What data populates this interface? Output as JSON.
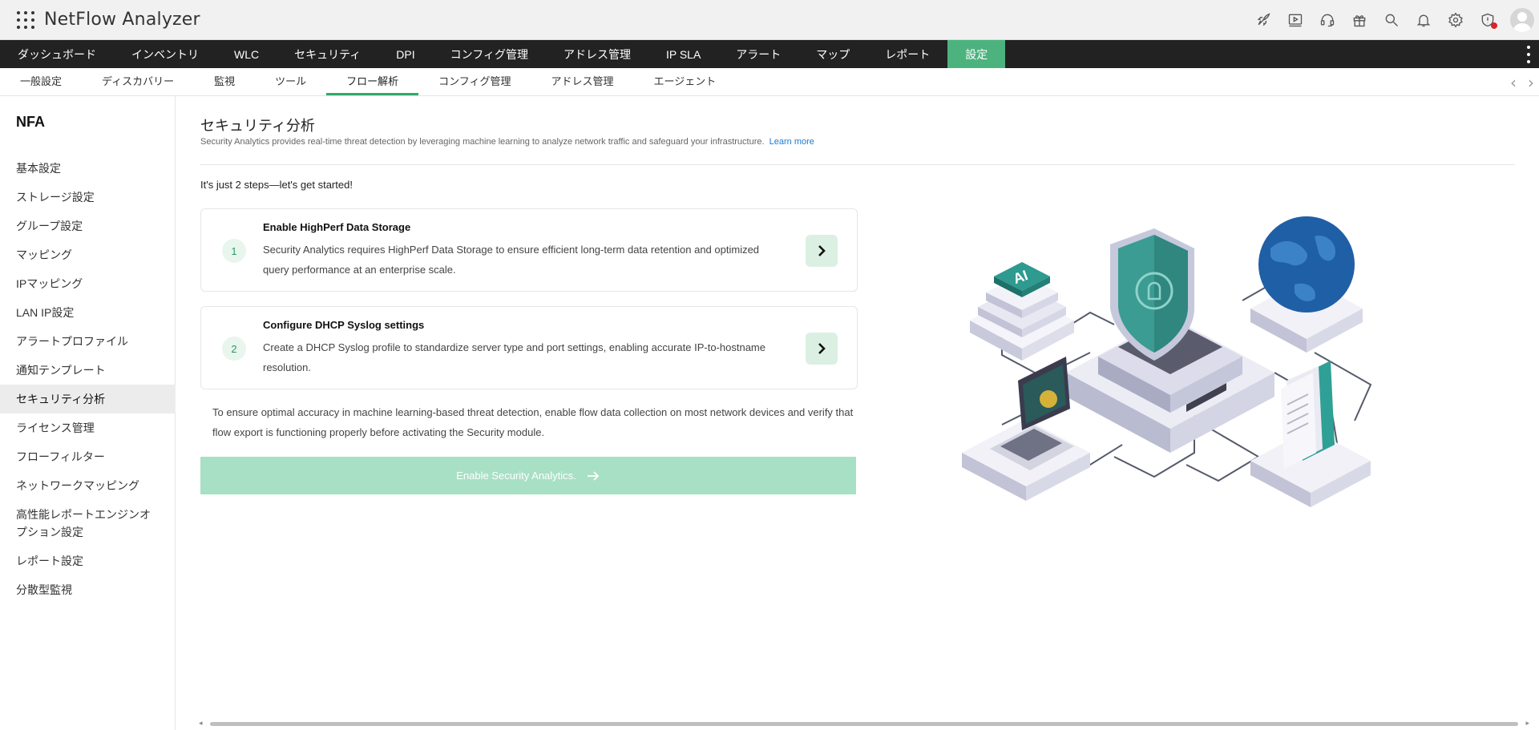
{
  "header": {
    "app_title": "NetFlow Analyzer",
    "icons": [
      "rocket-icon",
      "video-icon",
      "headset-icon",
      "gift-icon",
      "search-icon",
      "bell-icon",
      "gear-icon",
      "alert-shield-icon",
      "user-avatar"
    ]
  },
  "main_nav": {
    "items": [
      "ダッシュボード",
      "インベントリ",
      "WLC",
      "セキュリティ",
      "DPI",
      "コンフィグ管理",
      "アドレス管理",
      "IP SLA",
      "アラート",
      "マップ",
      "レポート",
      "設定"
    ],
    "active": "設定",
    "active_color": "#4db37e"
  },
  "sub_nav": {
    "items": [
      "一般設定",
      "ディスカバリー",
      "監視",
      "ツール",
      "フロー解析",
      "コンフィグ管理",
      "アドレス管理",
      "エージェント"
    ],
    "active": "フロー解析"
  },
  "sidebar": {
    "title": "NFA",
    "items": [
      "基本設定",
      "ストレージ設定",
      "グループ設定",
      "マッピング",
      "IPマッピング",
      "LAN IP設定",
      "アラートプロファイル",
      "通知テンプレート",
      "セキュリティ分析",
      "ライセンス管理",
      "フローフィルター",
      "ネットワークマッピング",
      "高性能レポートエンジンオプション設定",
      "レポート設定",
      "分散型監視"
    ],
    "active": "セキュリティ分析"
  },
  "main": {
    "title": "セキュリティ分析",
    "description": "Security Analytics provides real-time threat detection by leveraging machine learning to analyze network traffic and safeguard your infrastructure.",
    "learn_more": "Learn more",
    "intro": "It's just 2 steps—let's get started!",
    "steps": [
      {
        "number": "1",
        "title": "Enable HighPerf Data Storage",
        "text": "Security Analytics requires HighPerf Data Storage to ensure efficient long-term data retention and optimized query performance at an enterprise scale."
      },
      {
        "number": "2",
        "title": "Configure DHCP Syslog settings",
        "text": "Create a DHCP Syslog profile to standardize server type and port settings, enabling accurate IP-to-hostname resolution."
      }
    ],
    "note": "To ensure optimal accuracy in machine learning-based threat detection, enable flow data collection on most network devices and verify that flow export is functioning properly before activating the Security module.",
    "enable_button": "Enable Security Analytics.",
    "illustration_label": "AI"
  },
  "colors": {
    "accent": "#4db37e",
    "button_disabled": "#a8e0c5",
    "link": "#1a7bd3"
  }
}
